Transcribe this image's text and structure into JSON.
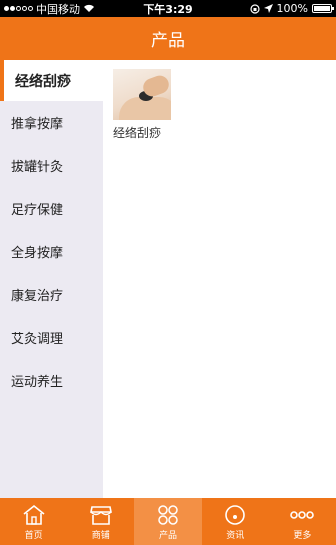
{
  "status_bar": {
    "carrier": "中国移动",
    "time": "下午3:29",
    "battery": "100%"
  },
  "header": {
    "title": "产品"
  },
  "sidebar": {
    "items": [
      {
        "label": "经络刮痧",
        "active": true
      },
      {
        "label": "推拿按摩",
        "active": false
      },
      {
        "label": "拔罐针灸",
        "active": false
      },
      {
        "label": "足疗保健",
        "active": false
      },
      {
        "label": "全身按摩",
        "active": false
      },
      {
        "label": "康复治疗",
        "active": false
      },
      {
        "label": "艾灸调理",
        "active": false
      },
      {
        "label": "运动养生",
        "active": false
      }
    ]
  },
  "products": [
    {
      "name": "经络刮痧"
    }
  ],
  "tab_bar": {
    "tabs": [
      {
        "label": "首页",
        "icon": "home-icon"
      },
      {
        "label": "商铺",
        "icon": "shop-icon"
      },
      {
        "label": "产品",
        "icon": "product-icon",
        "active": true
      },
      {
        "label": "资讯",
        "icon": "news-icon"
      },
      {
        "label": "更多",
        "icon": "more-icon"
      }
    ]
  },
  "colors": {
    "accent": "#ef7418",
    "sidebar_bg": "#eceaf2"
  }
}
